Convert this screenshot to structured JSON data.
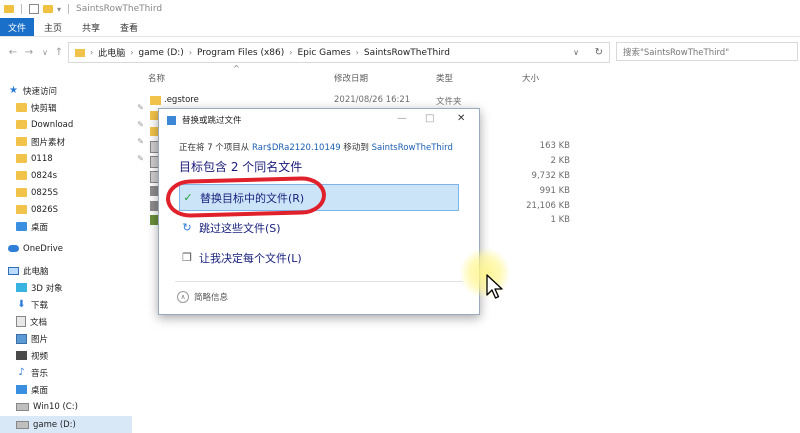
{
  "window": {
    "title": "SaintsRowTheThird"
  },
  "ribbon": {
    "tabs": [
      "文件",
      "主页",
      "共享",
      "查看"
    ]
  },
  "address": {
    "segments": [
      "此电脑",
      "game (D:)",
      "Program Files (x86)",
      "Epic Games",
      "SaintsRowTheThird"
    ],
    "search_placeholder": "搜索\"SaintsRowTheThird\""
  },
  "sidebar": {
    "quick_access": "快速访问",
    "items": [
      {
        "label": "快剪辑",
        "icon": "folder-icon",
        "pinned": true
      },
      {
        "label": "Download",
        "icon": "folder-icon",
        "pinned": true
      },
      {
        "label": "图片素材",
        "icon": "folder-icon",
        "pinned": true
      },
      {
        "label": "0118",
        "icon": "folder-icon",
        "pinned": true
      },
      {
        "label": "0824s",
        "icon": "folder-icon",
        "pinned": false
      },
      {
        "label": "0825S",
        "icon": "folder-icon",
        "pinned": false
      },
      {
        "label": "0826S",
        "icon": "folder-icon",
        "pinned": false
      },
      {
        "label": "桌面",
        "icon": "folder-icon",
        "pinned": false
      }
    ],
    "onedrive": "OneDrive",
    "this_pc": "此电脑",
    "pc_items": [
      {
        "label": "3D 对象",
        "icon": "cube-icon"
      },
      {
        "label": "下载",
        "icon": "download-icon"
      },
      {
        "label": "文档",
        "icon": "document-icon"
      },
      {
        "label": "图片",
        "icon": "picture-icon"
      },
      {
        "label": "视频",
        "icon": "video-icon"
      },
      {
        "label": "音乐",
        "icon": "music-icon"
      },
      {
        "label": "桌面",
        "icon": "desktop-icon"
      },
      {
        "label": "Win10 (C:)",
        "icon": "drive-icon"
      },
      {
        "label": "game (D:)",
        "icon": "drive-icon"
      }
    ]
  },
  "columns": {
    "name": "名称",
    "modified": "修改日期",
    "type": "类型",
    "size": "大小"
  },
  "files": [
    {
      "name": ".egstore",
      "modified": "2021/08/26 16:21",
      "type": "文件夹",
      "size": ""
    },
    {
      "name": "",
      "modified": "",
      "type": "",
      "size": ""
    },
    {
      "name": "",
      "modified": "",
      "type": "",
      "size": ""
    },
    {
      "name": "",
      "modified": "",
      "type": "",
      "size": "163 KB"
    },
    {
      "name": "",
      "modified": "",
      "type": "",
      "size": "2 KB"
    },
    {
      "name": "",
      "modified": "",
      "type": "",
      "size": "9,732 KB"
    },
    {
      "name": "",
      "modified": "",
      "type": "",
      "size": "991 KB"
    },
    {
      "name": "",
      "modified": "",
      "type": "",
      "size": "21,106 KB"
    },
    {
      "name": "",
      "modified": "",
      "type": "",
      "size": "1 KB"
    }
  ],
  "dialog": {
    "title": "替换或跳过文件",
    "line_prefix": "正在将 7 个项目从 ",
    "line_source": "Rar$DRa2120.10149",
    "line_mid": " 移动到 ",
    "line_dest": "SaintsRowTheThird",
    "heading": "目标包含 2 个同名文件",
    "options": [
      {
        "label": "替换目标中的文件(R)",
        "icon": "checkmark-icon"
      },
      {
        "label": "跳过这些文件(S)",
        "icon": "skip-icon"
      },
      {
        "label": "让我决定每个文件(L)",
        "icon": "compare-icon"
      }
    ],
    "less_info": "简略信息"
  }
}
